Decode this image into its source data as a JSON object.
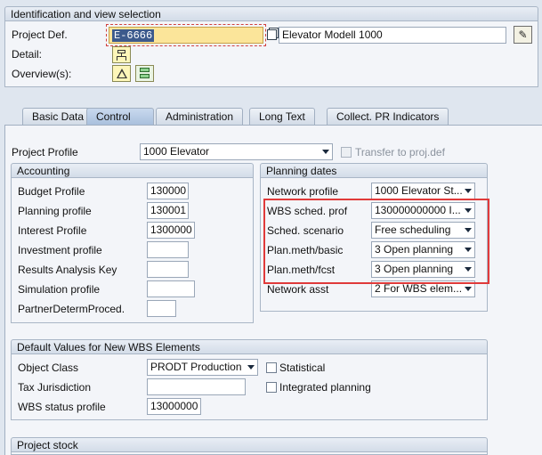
{
  "header": {
    "group_title": "Identification and view selection",
    "project_def_label": "Project Def.",
    "project_def_value": "E-6666",
    "project_desc": "Elevator Modell 1000",
    "detail_label": "Detail:",
    "overview_label": "Overview(s):"
  },
  "tabs": [
    {
      "label": "Basic Data"
    },
    {
      "label": "Control"
    },
    {
      "label": "Administration"
    },
    {
      "label": "Long Text"
    },
    {
      "label": "Collect. PR Indicators"
    }
  ],
  "control": {
    "project_profile_label": "Project Profile",
    "project_profile_value": "1000 Elevator",
    "transfer_label": "Transfer to proj.def"
  },
  "accounting": {
    "title": "Accounting",
    "rows": [
      {
        "label": "Budget Profile",
        "value": "130000"
      },
      {
        "label": "Planning profile",
        "value": "130001"
      },
      {
        "label": "Interest Profile",
        "value": "1300000"
      },
      {
        "label": "Investment profile",
        "value": ""
      },
      {
        "label": "Results Analysis Key",
        "value": ""
      },
      {
        "label": "Simulation profile",
        "value": ""
      },
      {
        "label": "PartnerDetermProced.",
        "value": ""
      }
    ]
  },
  "planning": {
    "title": "Planning dates",
    "rows": [
      {
        "label": "Network profile",
        "value": "1000 Elevator St..."
      },
      {
        "label": "WBS sched. prof",
        "value": "130000000000 I..."
      },
      {
        "label": "Sched. scenario",
        "value": "Free scheduling"
      },
      {
        "label": "Plan.meth/basic",
        "value": "3 Open planning"
      },
      {
        "label": "Plan.meth/fcst",
        "value": "3 Open planning"
      },
      {
        "label": "Network asst",
        "value": "2 For WBS elem..."
      }
    ],
    "highlight_color": "#e03a3a"
  },
  "defaults": {
    "title": "Default Values for New WBS Elements",
    "object_class_label": "Object Class",
    "object_class_value": "PRODT Production",
    "tax_label": "Tax Jurisdiction",
    "tax_value": "",
    "wbs_status_label": "WBS status profile",
    "wbs_status_value": "13000000",
    "statistical_label": "Statistical",
    "integrated_label": "Integrated planning"
  },
  "stock": {
    "title": "Project stock"
  }
}
